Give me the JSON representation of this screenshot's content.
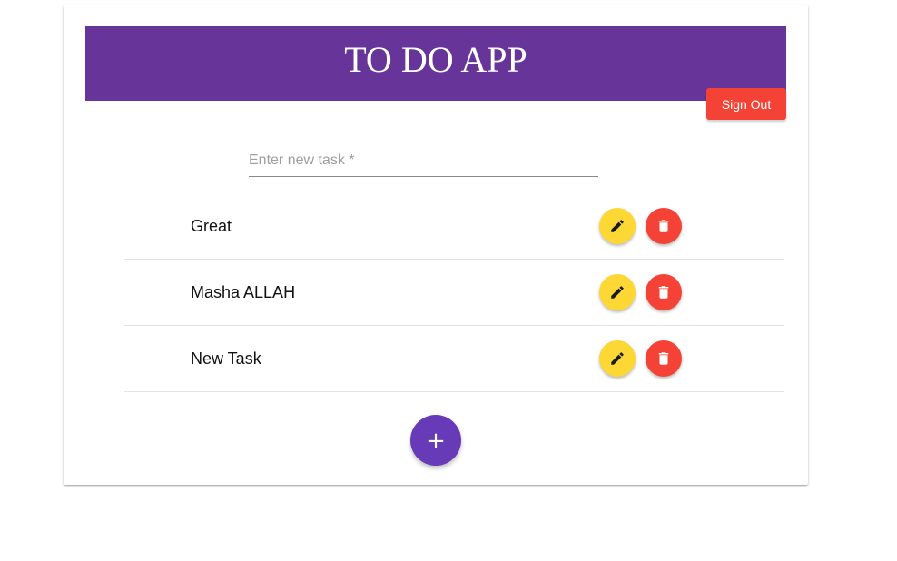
{
  "app": {
    "title": "TO DO APP"
  },
  "header": {
    "sign_out_label": "Sign Out"
  },
  "new_task": {
    "value": "",
    "placeholder": "Enter new task *"
  },
  "tasks": [
    {
      "label": "Great",
      "edit_icon": "pencil-icon",
      "delete_icon": "trash-icon"
    },
    {
      "label": "Masha ALLAH",
      "edit_icon": "pencil-icon",
      "delete_icon": "trash-icon"
    },
    {
      "label": "New Task",
      "edit_icon": "pencil-icon",
      "delete_icon": "trash-icon"
    }
  ],
  "add_button": {
    "label": "+"
  },
  "colors": {
    "header_bg": "#673599",
    "sign_out_bg": "#f44336",
    "edit_bg": "#fdd835",
    "delete_bg": "#f44336",
    "fab_bg": "#673ab7"
  }
}
